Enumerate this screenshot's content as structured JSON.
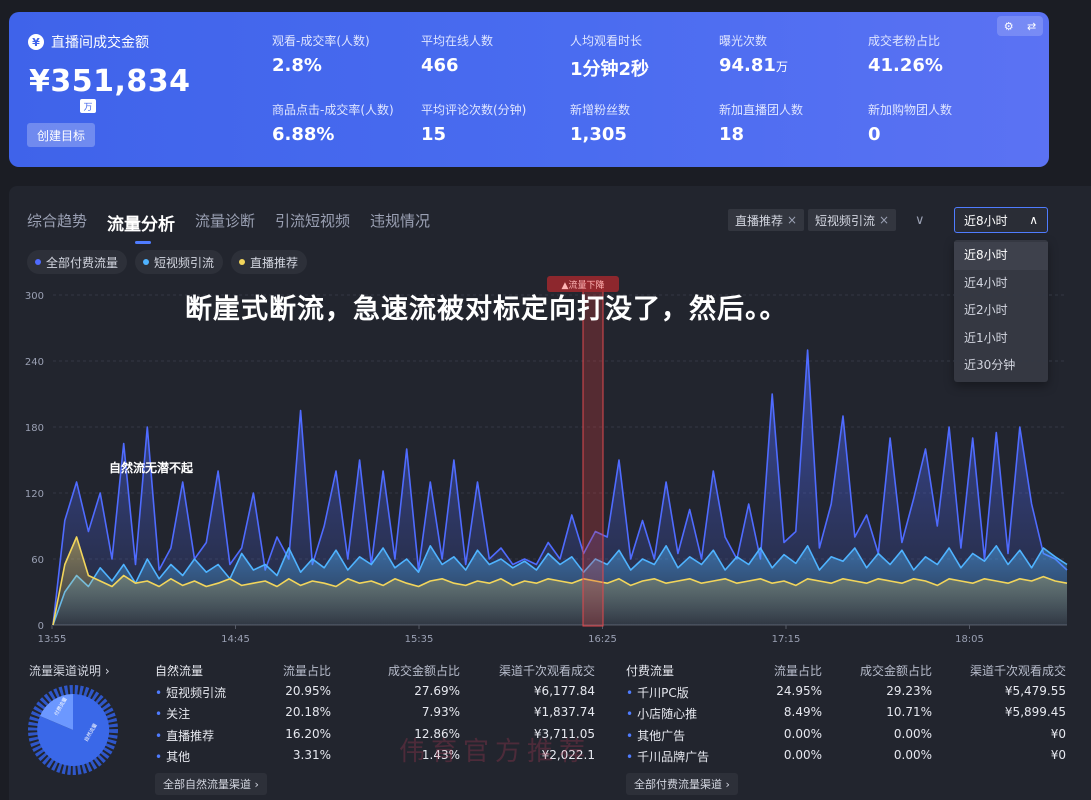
{
  "banner": {
    "gmv_label": "直播间成交金额",
    "gmv_icon": "yen-circle-icon",
    "gmv_value": "¥351,834",
    "gmv_unit": "万",
    "target_button": "创建目标",
    "metrics_row1": [
      {
        "label": "观看-成交率(人数)",
        "value": "2.8%",
        "unit": ""
      },
      {
        "label": "平均在线人数",
        "value": "466",
        "unit": ""
      },
      {
        "label": "人均观看时长",
        "value": "1分钟2秒",
        "unit": ""
      },
      {
        "label": "曝光次数",
        "value": "94.81",
        "unit": "万"
      },
      {
        "label": "成交老粉占比",
        "value": "41.26%",
        "unit": ""
      }
    ],
    "metrics_row2": [
      {
        "label": "商品点击-成交率(人数)",
        "value": "6.88%",
        "unit": ""
      },
      {
        "label": "平均评论次数(分钟)",
        "value": "15",
        "unit": ""
      },
      {
        "label": "新增粉丝数",
        "value": "1,305",
        "unit": ""
      },
      {
        "label": "新加直播团人数",
        "value": "18",
        "unit": ""
      },
      {
        "label": "新加购物团人数",
        "value": "0",
        "unit": ""
      }
    ],
    "icons": [
      "settings-icon",
      "swap-icon"
    ]
  },
  "tabs": [
    "综合趋势",
    "流量分析",
    "流量诊断",
    "引流短视频",
    "违规情况"
  ],
  "active_tab": "流量分析",
  "filter_chips": [
    "直播推荐",
    "短视频引流"
  ],
  "time_range": {
    "selected": "近8小时",
    "options": [
      "近8小时",
      "近4小时",
      "近2小时",
      "近1小时",
      "近30分钟"
    ]
  },
  "legend": [
    {
      "name": "全部付费流量",
      "color": "#4f6bff"
    },
    {
      "name": "短视频引流",
      "color": "#4fb3ff"
    },
    {
      "name": "直播推荐",
      "color": "#f2d55b"
    }
  ],
  "overlay_caption": "断崖式断流，急速流被对标定向打没了，然后。。",
  "annotation": "自然流无潜不起",
  "drop_marker": "▲流量下降",
  "chart_data": {
    "type": "area",
    "x_ticks": [
      "13:55",
      "14:45",
      "15:35",
      "16:25",
      "17:15",
      "18:05"
    ],
    "y_ticks": [
      0,
      60,
      120,
      180,
      240,
      300
    ],
    "ylim": [
      0,
      300
    ],
    "grid": true,
    "series": [
      {
        "name": "全部付费流量",
        "color": "#4f6bff",
        "values": [
          0,
          95,
          130,
          85,
          120,
          60,
          165,
          55,
          180,
          50,
          70,
          130,
          60,
          75,
          140,
          55,
          70,
          120,
          50,
          80,
          60,
          195,
          55,
          90,
          140,
          60,
          150,
          55,
          140,
          60,
          160,
          50,
          130,
          60,
          150,
          55,
          130,
          60,
          70,
          55,
          60,
          55,
          75,
          60,
          100,
          65,
          85,
          80,
          150,
          60,
          95,
          60,
          130,
          65,
          105,
          60,
          140,
          80,
          60,
          110,
          60,
          210,
          75,
          85,
          250,
          70,
          110,
          190,
          80,
          100,
          65,
          170,
          75,
          115,
          160,
          90,
          180,
          70,
          170,
          60,
          175,
          65,
          180,
          110,
          65,
          60,
          50
        ]
      },
      {
        "name": "短视频引流",
        "color": "#4fb3ff",
        "values": [
          0,
          30,
          45,
          35,
          52,
          40,
          55,
          38,
          60,
          42,
          55,
          45,
          60,
          48,
          55,
          42,
          65,
          50,
          55,
          45,
          70,
          48,
          60,
          52,
          68,
          50,
          62,
          55,
          70,
          52,
          60,
          48,
          72,
          55,
          62,
          50,
          68,
          55,
          60,
          52,
          58,
          50,
          65,
          55,
          62,
          48,
          60,
          55,
          68,
          50,
          60,
          55,
          72,
          52,
          62,
          55,
          68,
          50,
          62,
          55,
          70,
          52,
          64,
          56,
          72,
          50,
          62,
          58,
          70,
          52,
          65,
          55,
          68,
          50,
          62,
          55,
          70,
          52,
          65,
          58,
          72,
          55,
          68,
          52,
          70,
          62,
          55
        ]
      },
      {
        "name": "直播推荐",
        "color": "#f2d55b",
        "values": [
          0,
          55,
          80,
          45,
          40,
          35,
          45,
          38,
          40,
          35,
          42,
          36,
          40,
          35,
          38,
          42,
          36,
          38,
          40,
          35,
          42,
          36,
          40,
          38,
          35,
          42,
          38,
          40,
          36,
          42,
          38,
          35,
          40,
          42,
          38,
          36,
          40,
          38,
          42,
          36,
          40,
          38,
          42,
          40,
          38,
          42,
          40,
          38,
          42,
          36,
          40,
          42,
          38,
          40,
          42,
          38,
          40,
          42,
          38,
          40,
          42,
          38,
          40,
          36,
          42,
          40,
          38,
          42,
          40,
          38,
          42,
          40,
          38,
          42,
          40,
          36,
          42,
          40,
          38,
          42,
          40,
          38,
          42,
          40,
          44,
          40,
          38
        ]
      }
    ]
  },
  "channels": {
    "title": "流量渠道说明",
    "donut_labels": [
      "付费流量",
      "自然流量"
    ],
    "natural": {
      "header": [
        "自然流量",
        "流量占比",
        "成交金额占比",
        "渠道千次观看成交"
      ],
      "rows": [
        [
          "短视频引流",
          "20.95%",
          "27.69%",
          "¥6,177.84"
        ],
        [
          "关注",
          "20.18%",
          "7.93%",
          "¥1,837.74"
        ],
        [
          "直播推荐",
          "16.20%",
          "12.86%",
          "¥3,711.05"
        ],
        [
          "其他",
          "3.31%",
          "1.43%",
          "¥2,022.1"
        ]
      ],
      "more": "全部自然流量渠道"
    },
    "paid": {
      "header": [
        "付费流量",
        "流量占比",
        "成交金额占比",
        "渠道千次观看成交"
      ],
      "rows": [
        [
          "千川PC版",
          "24.95%",
          "29.23%",
          "¥5,479.55"
        ],
        [
          "小店随心推",
          "8.49%",
          "10.71%",
          "¥5,899.45"
        ],
        [
          "其他广告",
          "0.00%",
          "0.00%",
          "¥0"
        ],
        [
          "千川品牌广告",
          "0.00%",
          "0.00%",
          "¥0"
        ]
      ],
      "more": "全部付费流量渠道"
    }
  },
  "watermark": "伟育官方推荐"
}
